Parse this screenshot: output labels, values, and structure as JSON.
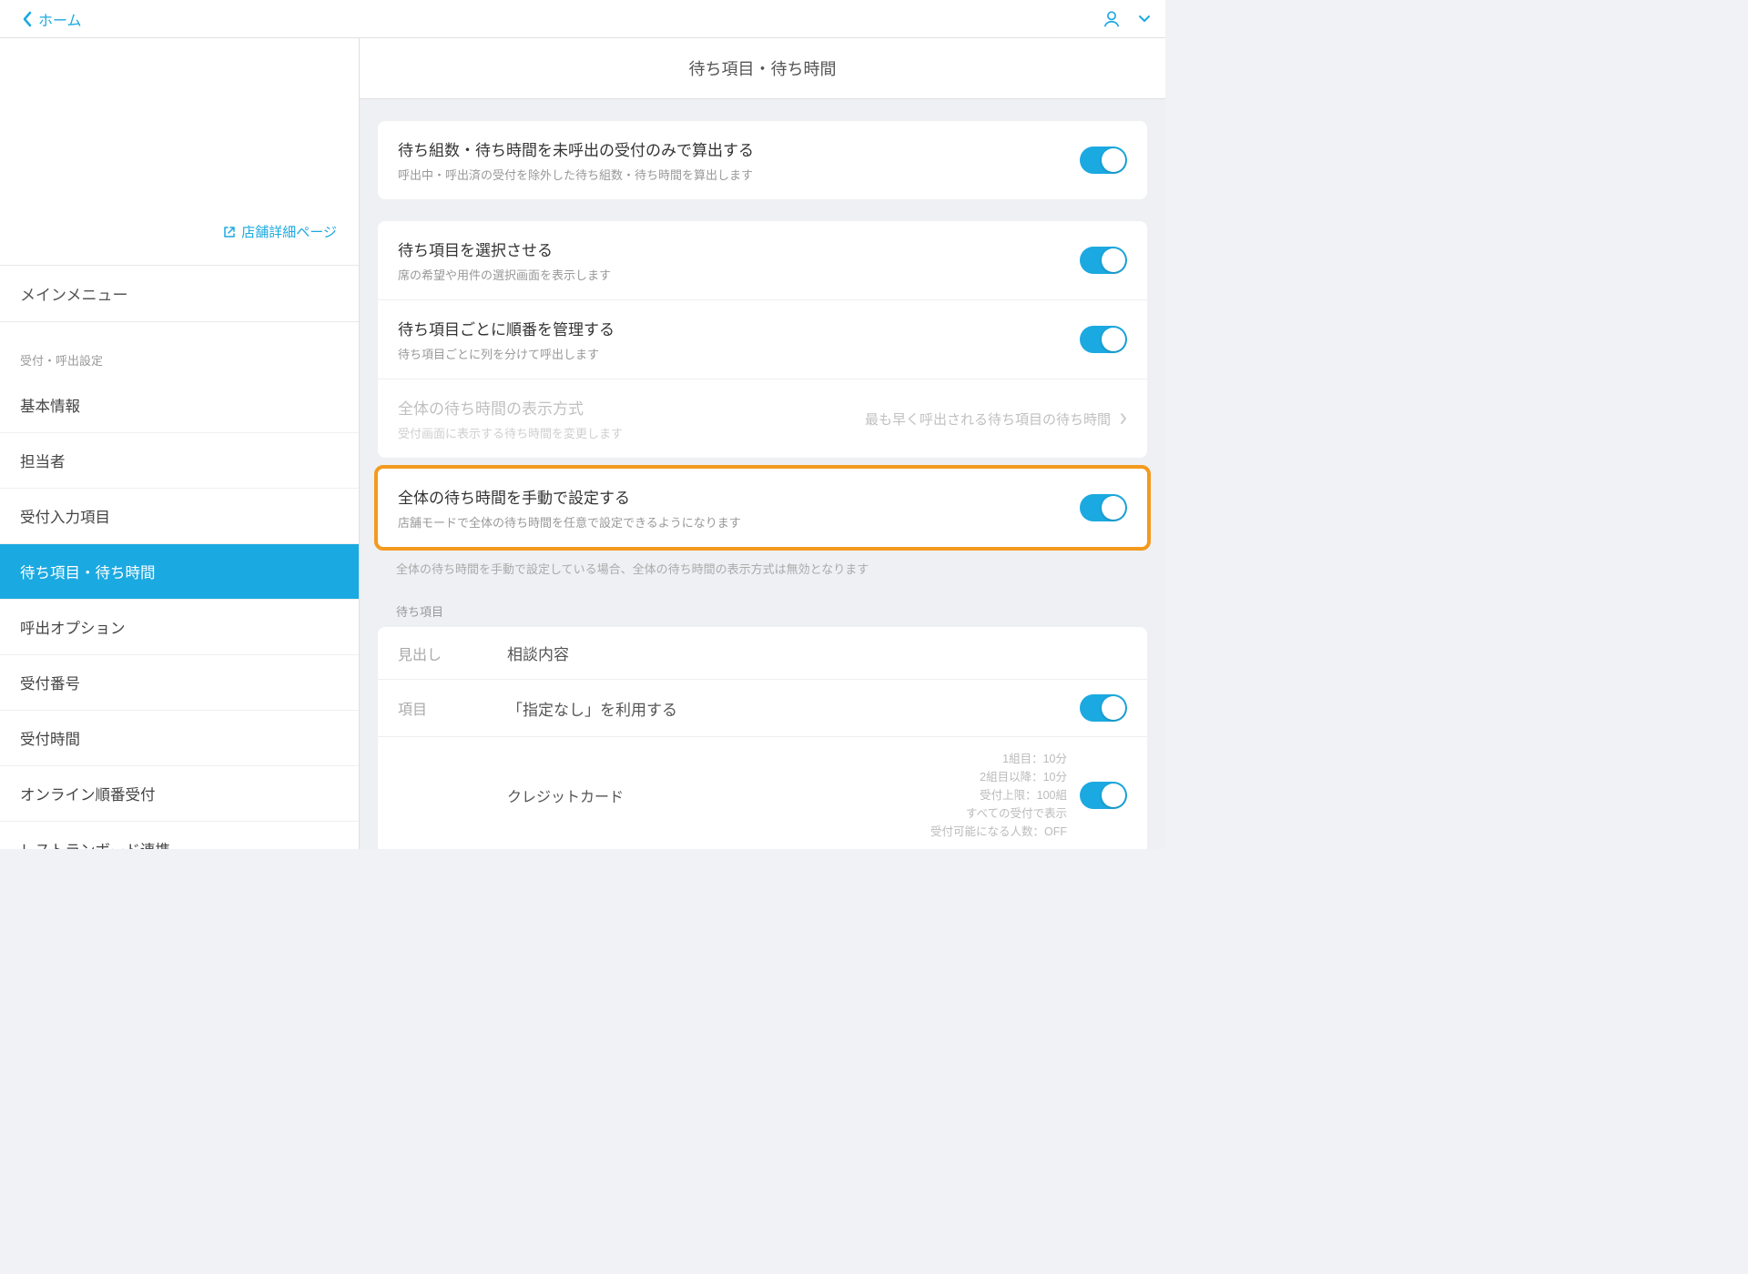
{
  "topbar": {
    "back_label": "ホーム"
  },
  "sidebar": {
    "store_detail_link": "店舗詳細ページ",
    "main_menu": "メインメニュー",
    "section_label": "受付・呼出設定",
    "items": [
      "基本情報",
      "担当者",
      "受付入力項目",
      "待ち項目・待ち時間",
      "呼出オプション",
      "受付番号",
      "受付時間",
      "オンライン順番受付",
      "レストランボード連携"
    ]
  },
  "content": {
    "header": "待ち項目・待ち時間",
    "row1": {
      "title": "待ち組数・待ち時間を未呼出の受付のみで算出する",
      "subtitle": "呼出中・呼出済の受付を除外した待ち組数・待ち時間を算出します"
    },
    "row2": {
      "title": "待ち項目を選択させる",
      "subtitle": "席の希望や用件の選択画面を表示します"
    },
    "row3": {
      "title": "待ち項目ごとに順番を管理する",
      "subtitle": "待ち項目ごとに列を分けて呼出します"
    },
    "row4": {
      "title": "全体の待ち時間の表示方式",
      "subtitle": "受付画面に表示する待ち時間を変更します",
      "value": "最も早く呼出される待ち項目の待ち時間"
    },
    "row5": {
      "title": "全体の待ち時間を手動で設定する",
      "subtitle": "店舗モードで全体の待ち時間を任意で設定できるようになります"
    },
    "footnote": "全体の待ち時間を手動で設定している場合、全体の待ち時間の表示方式は無効となります",
    "wait_items_label": "待ち項目",
    "heading_key": "見出し",
    "heading_val": "相談内容",
    "item_key": "項目",
    "item_val": "「指定なし」を利用する",
    "sub_item": {
      "name": "クレジットカード",
      "meta": [
        "1組目：10分",
        "2組目以降：10分",
        "受付上限：100組",
        "すべての受付で表示",
        "受付可能になる人数：OFF"
      ]
    }
  }
}
